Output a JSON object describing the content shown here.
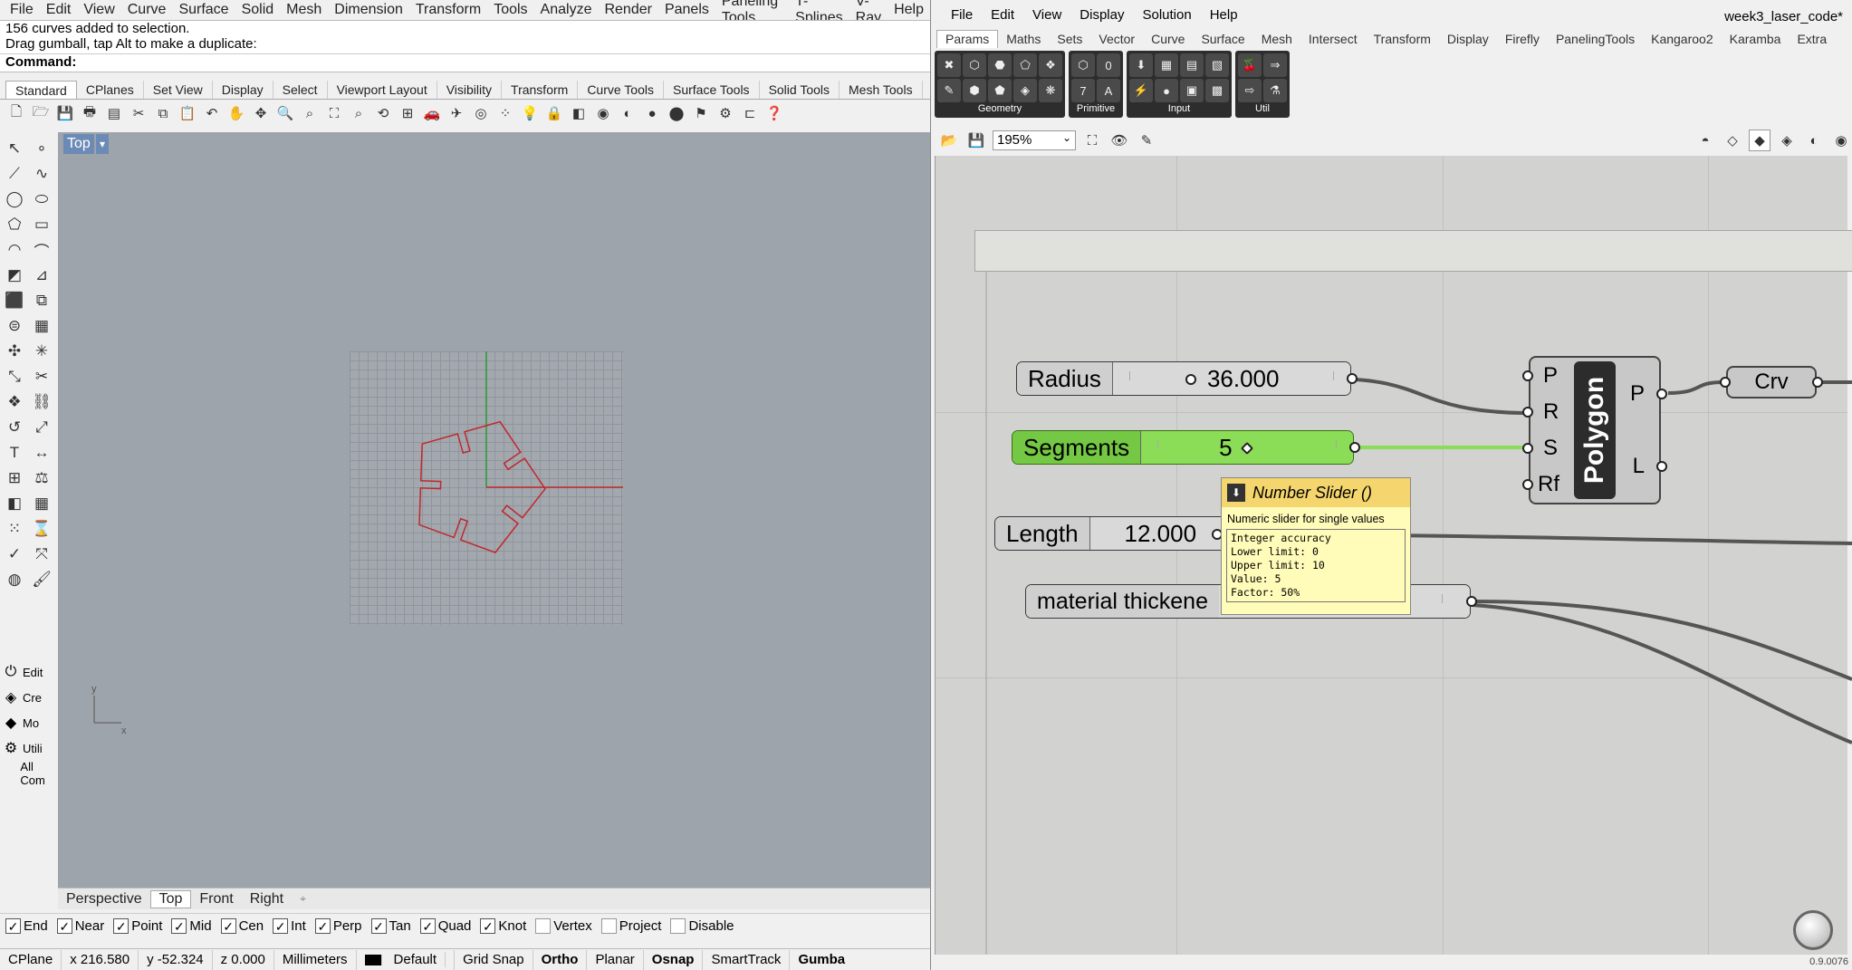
{
  "rhino": {
    "menu": [
      "File",
      "Edit",
      "View",
      "Curve",
      "Surface",
      "Solid",
      "Mesh",
      "Dimension",
      "Transform",
      "Tools",
      "Analyze",
      "Render",
      "Panels",
      "Paneling Tools",
      "T-Splines",
      "V-Ray",
      "Help"
    ],
    "history": [
      "156 curves added to selection.",
      "Drag gumball, tap Alt to make a duplicate:"
    ],
    "command_label": "Command:",
    "tabs": [
      "Standard",
      "CPlanes",
      "Set View",
      "Display",
      "Select",
      "Viewport Layout",
      "Visibility",
      "Transform",
      "Curve Tools",
      "Surface Tools",
      "Solid Tools",
      "Mesh Tools"
    ],
    "active_tab": "Standard",
    "viewport_name": "Top",
    "axis_y": "y",
    "axis_x": "x",
    "viewport_tabs": [
      "Perspective",
      "Top",
      "Front",
      "Right"
    ],
    "add_tab": "⌖",
    "panel_items": [
      {
        "icon": "⏻",
        "label": "Edit"
      },
      {
        "icon": "◈",
        "label": "Cre"
      },
      {
        "icon": "◆",
        "label": "Mo"
      },
      {
        "icon": "⚙",
        "label": "Utili"
      },
      {
        "icon": "",
        "label": "All Com"
      }
    ],
    "osnaps": [
      {
        "label": "End",
        "checked": true
      },
      {
        "label": "Near",
        "checked": true
      },
      {
        "label": "Point",
        "checked": true
      },
      {
        "label": "Mid",
        "checked": true
      },
      {
        "label": "Cen",
        "checked": true
      },
      {
        "label": "Int",
        "checked": true
      },
      {
        "label": "Perp",
        "checked": true
      },
      {
        "label": "Tan",
        "checked": true
      },
      {
        "label": "Quad",
        "checked": true
      },
      {
        "label": "Knot",
        "checked": true
      },
      {
        "label": "Vertex",
        "checked": false
      },
      {
        "label": "Project",
        "checked": false
      },
      {
        "label": "Disable",
        "checked": false
      }
    ],
    "status": {
      "cplane": "CPlane",
      "x": "x 216.580",
      "y": "y -52.324",
      "z": "z 0.000",
      "units": "Millimeters",
      "layer": "Default",
      "grid_snap": "Grid Snap",
      "ortho": "Ortho",
      "planar": "Planar",
      "osnap": "Osnap",
      "smarttrack": "SmartTrack",
      "gumball": "Gumba"
    },
    "curve_color": "#c0282d"
  },
  "gh": {
    "menu": [
      "File",
      "Edit",
      "View",
      "Display",
      "Solution",
      "Help"
    ],
    "title": "week3_laser_code*",
    "tabs": [
      "Params",
      "Maths",
      "Sets",
      "Vector",
      "Curve",
      "Surface",
      "Mesh",
      "Intersect",
      "Transform",
      "Display",
      "Firefly",
      "PanelingTools",
      "Kangaroo2",
      "Karamba",
      "Extra"
    ],
    "active_tab": "Params",
    "ribbon_groups": [
      {
        "label": "Geometry",
        "icons": [
          "✖",
          "✎",
          "⬡",
          "⬢",
          "⬣",
          "⬟",
          "⬠",
          "◈",
          "❖",
          "❋"
        ]
      },
      {
        "label": "Primitive",
        "icons": [
          "⬡",
          "7",
          "0",
          "A"
        ]
      },
      {
        "label": "Input",
        "icons": [
          "⬇",
          "⚡",
          "▦",
          "●",
          "▤",
          "▣",
          "▧",
          "▩"
        ]
      },
      {
        "label": "Util",
        "icons": [
          "🍒",
          "⇨",
          "⇒",
          "⚗"
        ]
      }
    ],
    "zoom": "195%",
    "sliders": {
      "radius": {
        "name": "Radius",
        "value": "36.000"
      },
      "segments": {
        "name": "Segments",
        "value": "5"
      },
      "length": {
        "name": "Length",
        "value": "12.000"
      },
      "thickness": {
        "name": "material thickene"
      }
    },
    "polygon": {
      "name": "Polygon",
      "inputs": [
        "P",
        "R",
        "S",
        "Rf"
      ],
      "outputs": [
        "P",
        "L"
      ]
    },
    "crv": "Crv",
    "tooltip": {
      "title": "Number Slider ()",
      "desc": "Numeric slider for single values",
      "details": [
        "Integer accuracy",
        "Lower limit: 0",
        "Upper limit: 10",
        "Value: 5",
        "Factor: 50%"
      ]
    },
    "version": "0.9.0076",
    "wire_color": "#555555",
    "active_wire_color": "#8bdc57"
  }
}
